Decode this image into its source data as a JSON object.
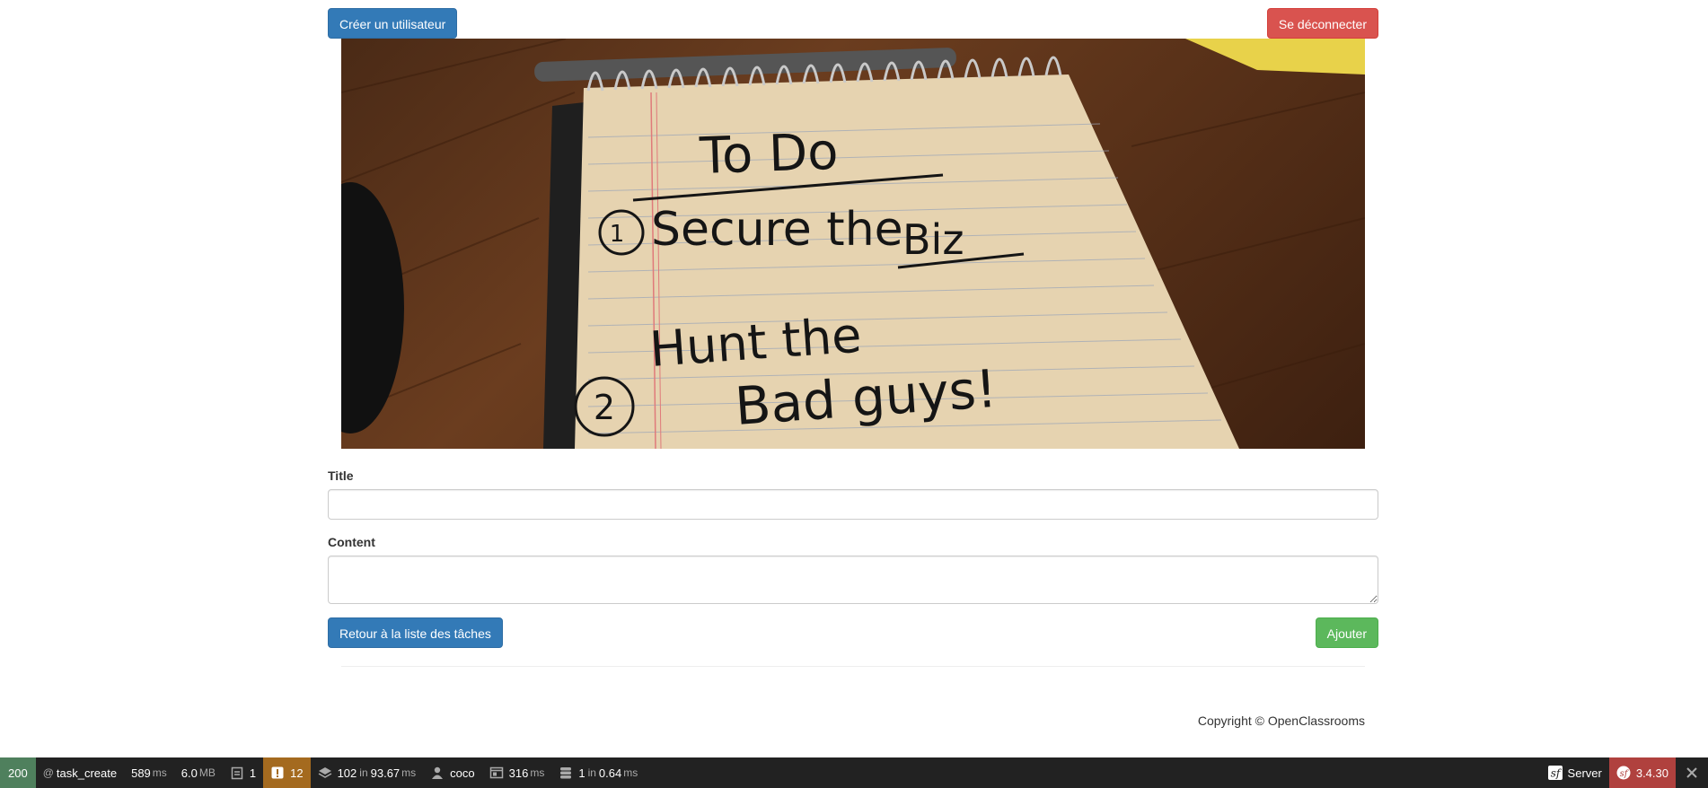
{
  "header": {
    "create_user_label": "Créer un utilisateur",
    "logout_label": "Se déconnecter"
  },
  "hero": {
    "image_name": "todo-notepad-photo",
    "notepad_text": {
      "line1": "To Do",
      "line2": "Secure the",
      "line3": "Biz",
      "line4": "Hunt the",
      "line5": "Bad guys!"
    }
  },
  "form": {
    "title_label": "Title",
    "title_value": "",
    "content_label": "Content",
    "content_value": ""
  },
  "actions": {
    "back_label": "Retour à la liste des tâches",
    "add_label": "Ajouter"
  },
  "footer": {
    "copyright": "Copyright © OpenClassrooms"
  },
  "toolbar": {
    "status_code": "200",
    "route_prefix": "@",
    "route": "task_create",
    "time_value": "589",
    "time_unit": "ms",
    "memory_value": "6.0",
    "memory_unit": "MB",
    "forms_count": "1",
    "warnings_count": "12",
    "cache_count": "102",
    "cache_in": "in",
    "cache_time": "93.67",
    "cache_unit": "ms",
    "user": "coco",
    "twig_time": "316",
    "twig_unit": "ms",
    "db_count": "1",
    "db_in": "in",
    "db_time": "0.64",
    "db_unit": "ms",
    "server_label": "Server",
    "version": "3.4.30"
  },
  "colors": {
    "primary": "#337ab7",
    "danger": "#d9534f",
    "success": "#5cb85c",
    "toolbar_bg": "#222222",
    "status_ok": "#4f805d",
    "warning": "#a46a1f",
    "version_bg": "#b0413e"
  }
}
